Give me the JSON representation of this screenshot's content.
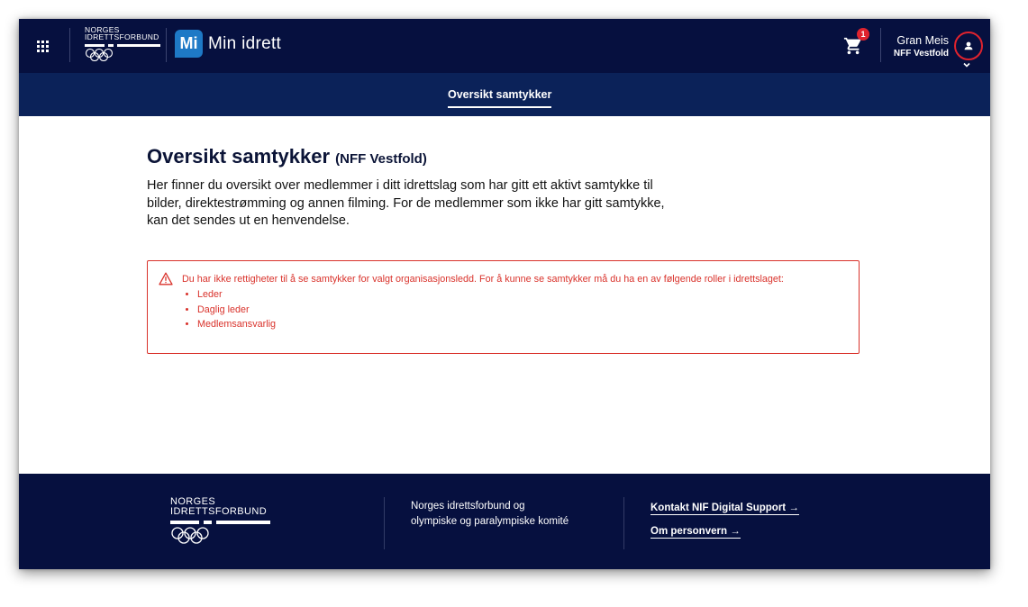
{
  "header": {
    "logo_text": [
      "NORGES",
      "IDRETTSFORBUND"
    ],
    "app_badge": "Mi",
    "app_title": "Min idrett",
    "cart_count": "1",
    "user_name": "Gran Meis",
    "user_org": "NFF Vestfold"
  },
  "subnav": {
    "tabs": [
      {
        "label": "Oversikt samtykker",
        "active": true
      }
    ]
  },
  "main": {
    "title": "Oversikt samtykker",
    "title_org": "(NFF Vestfold)",
    "intro": "Her finner du oversikt over medlemmer i ditt idrettslag som har gitt ett aktivt samtykke til bilder, direktestrømming og annen filming. For de medlemmer som ikke har gitt samtykke, kan det sendes ut en henvendelse."
  },
  "alert": {
    "message": "Du har ikke rettigheter til å se samtykker for valgt organisasjonsledd. For å kunne se samtykker må du ha en av følgende roller i idrettslaget:",
    "roles": [
      "Leder",
      "Daglig leder",
      "Medlemsansvarlig"
    ]
  },
  "footer": {
    "logo_text": [
      "NORGES",
      "IDRETTSFORBUND"
    ],
    "org_lines": [
      "Norges idrettsforbund og",
      "olympiske og paralympiske komité"
    ],
    "links": [
      "Kontakt NIF Digital Support →",
      "Om personvern →"
    ]
  },
  "colors": {
    "header_bg": "#06103f",
    "subnav_bg": "#0b2259",
    "accent_blue": "#1e79c6",
    "error_red": "#d9322b",
    "badge_red": "#e0232e"
  },
  "icons": [
    "app-grid-icon",
    "olympic-rings-icon",
    "cart-icon",
    "user-icon",
    "chevron-down-icon",
    "warning-icon"
  ]
}
